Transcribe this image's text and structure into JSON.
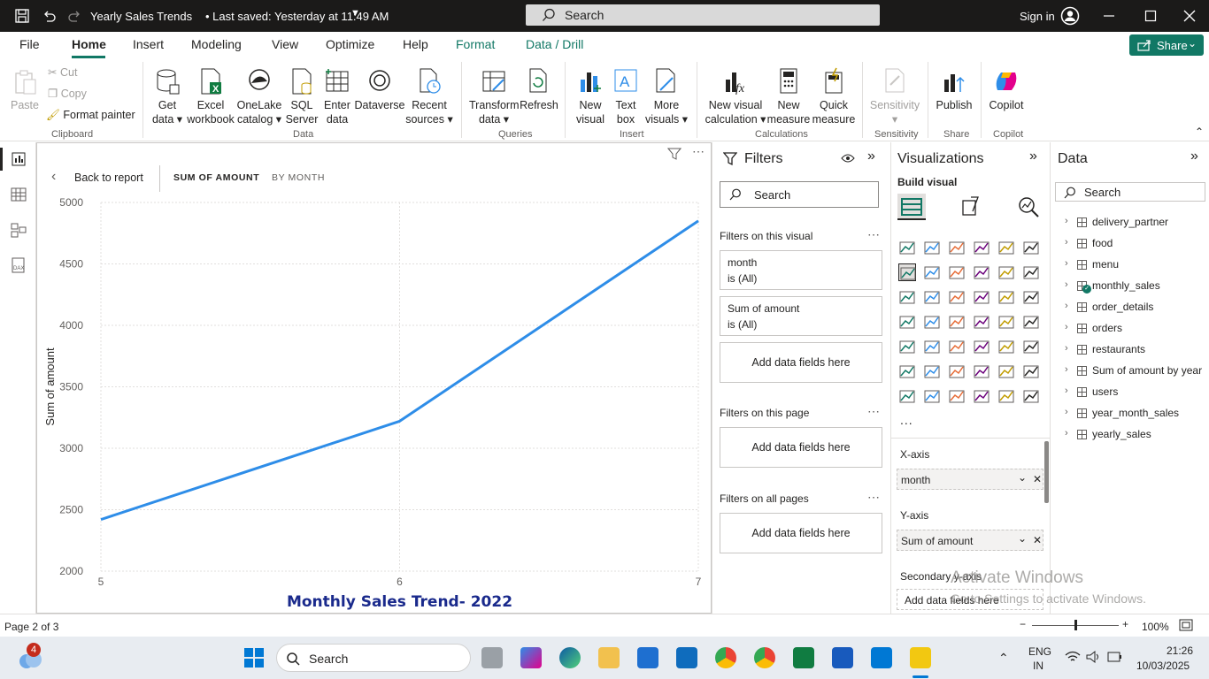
{
  "titlebar": {
    "doc_title": "Yearly Sales Trends",
    "saved_status": "• Last saved: Yesterday at 11:49 AM",
    "search_placeholder": "Search",
    "signin": "Sign in"
  },
  "menu": {
    "items": [
      "File",
      "Home",
      "Insert",
      "Modeling",
      "View",
      "Optimize",
      "Help",
      "Format",
      "Data / Drill"
    ],
    "active": "Home",
    "share": "Share"
  },
  "ribbon": {
    "clipboard": {
      "paste": "Paste",
      "cut": "Cut",
      "copy": "Copy",
      "format_painter": "Format painter",
      "group": "Clipboard"
    },
    "data": {
      "get_data": [
        "Get",
        "data ▾"
      ],
      "excel": [
        "Excel",
        "workbook"
      ],
      "onelake": [
        "OneLake",
        "catalog ▾"
      ],
      "sql": [
        "SQL",
        "Server"
      ],
      "enter": [
        "Enter",
        "data"
      ],
      "dataverse": [
        "Dataverse",
        ""
      ],
      "recent": [
        "Recent",
        "sources ▾"
      ],
      "group": "Data"
    },
    "queries": {
      "transform": [
        "Transform",
        "data ▾"
      ],
      "refresh": [
        "Refresh",
        ""
      ],
      "group": "Queries"
    },
    "insert": {
      "new_visual": [
        "New",
        "visual"
      ],
      "text_box": [
        "Text",
        "box"
      ],
      "more_visuals": [
        "More",
        "visuals ▾"
      ],
      "group": "Insert"
    },
    "calculations": {
      "new_visual_calc": [
        "New visual",
        "calculation ▾"
      ],
      "new_measure": [
        "New",
        "measure"
      ],
      "quick_measure": [
        "Quick",
        "measure"
      ],
      "group": "Calculations"
    },
    "sensitivity": {
      "label": [
        "Sensitivity",
        "▾"
      ],
      "group": "Sensitivity"
    },
    "share": {
      "publish": [
        "Publish",
        ""
      ],
      "group": "Share"
    },
    "copilot": {
      "label": [
        "Copilot",
        ""
      ],
      "group": "Copilot"
    }
  },
  "canvas": {
    "back": "Back to report",
    "tab_sum": "SUM OF AMOUNT",
    "tab_month": "BY MONTH"
  },
  "chart_data": {
    "type": "line",
    "title": "Monthly Sales Trend- 2022",
    "xlabel": "",
    "ylabel": "Sum of amount",
    "x": [
      5,
      6,
      7
    ],
    "series": [
      {
        "values": [
          2420,
          3220,
          4850
        ]
      }
    ],
    "ylim": [
      2000,
      5000
    ],
    "yticks": [
      2000,
      2500,
      3000,
      3500,
      4000,
      4500,
      5000
    ],
    "xticks": [
      5,
      6,
      7
    ],
    "color": "#2e8de8",
    "grid": true
  },
  "filters": {
    "title": "Filters",
    "search": "Search",
    "on_visual": "Filters on this visual",
    "card1_name": "month",
    "card1_val": "is (All)",
    "card2_name": "Sum of amount",
    "card2_val": "is (All)",
    "add_fields": "Add data fields here",
    "on_page": "Filters on this page",
    "on_all": "Filters on all pages"
  },
  "viz": {
    "title": "Visualizations",
    "build": "Build visual",
    "xaxis_label": "X-axis",
    "xaxis_value": "month",
    "yaxis_label": "Y-axis",
    "yaxis_value": "Sum of amount",
    "secondary_label": "Secondary y-axis",
    "add_fields": "Add data fields here",
    "more": "..."
  },
  "data": {
    "title": "Data",
    "search": "Search",
    "tables": [
      "delivery_partner",
      "food",
      "menu",
      "monthly_sales",
      "order_details",
      "orders",
      "restaurants",
      "Sum of amount by year",
      "users",
      "year_month_sales",
      "yearly_sales"
    ]
  },
  "status": {
    "page": "Page 2 of 3",
    "zoom": "100%",
    "zoom_level": 1.0
  },
  "watermark": {
    "line1": "Activate Windows",
    "line2": "Go to Settings to activate Windows."
  },
  "taskbar": {
    "search": "Search",
    "weather_badge": "4",
    "lang1": "ENG",
    "lang2": "IN",
    "time": "21:26",
    "date": "10/03/2025"
  }
}
